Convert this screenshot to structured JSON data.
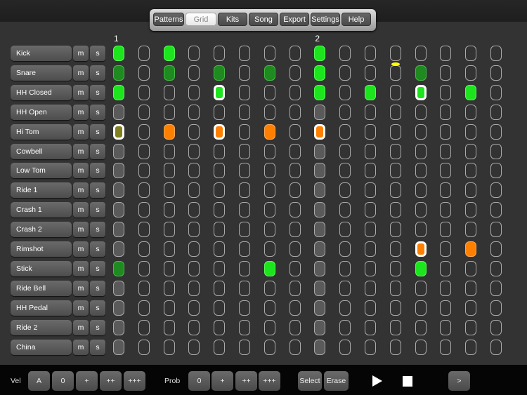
{
  "tabs": [
    {
      "label": "Patterns"
    },
    {
      "label": "Grid",
      "active": true
    },
    {
      "label": "Kits"
    },
    {
      "label": "Song"
    },
    {
      "label": "Export"
    },
    {
      "label": "Settings"
    },
    {
      "label": "Help"
    }
  ],
  "bar_markers": [
    "1",
    "2"
  ],
  "mute_label": "m",
  "solo_label": "s",
  "playhead_step": 11,
  "colors": {
    "bright_green": "#1de51d",
    "dark_green": "#1f8a1f",
    "orange": "#ff8000",
    "olive": "#808020",
    "playhead": "#ffff00"
  },
  "cell_legend": {
    ".": "off",
    "G": "on-high",
    "g": "on-low",
    "O": "on-orange",
    "y": "on-olive",
    "*": "selected"
  },
  "tracks": [
    {
      "name": "Kick",
      "steps": [
        "G",
        ".",
        "G",
        ".",
        ".",
        ".",
        ".",
        ".",
        "G",
        ".",
        ".",
        ".",
        ".",
        ".",
        ".",
        "."
      ]
    },
    {
      "name": "Snare",
      "steps": [
        "g",
        ".",
        "g",
        ".",
        "g",
        ".",
        "g",
        ".",
        "G",
        ".",
        ".",
        ".",
        "g",
        ".",
        ".",
        "."
      ]
    },
    {
      "name": "HH Closed",
      "steps": [
        "G",
        ".",
        ".",
        ".",
        "G*",
        ".",
        ".",
        ".",
        "G",
        ".",
        "G",
        ".",
        "G*",
        ".",
        "G",
        "."
      ]
    },
    {
      "name": "HH Open",
      "steps": [
        ".",
        ".",
        ".",
        ".",
        ".",
        ".",
        ".",
        ".",
        ".",
        ".",
        ".",
        ".",
        ".",
        ".",
        ".",
        "."
      ]
    },
    {
      "name": "Hi Tom",
      "steps": [
        "y*",
        ".",
        "O",
        ".",
        "O*",
        ".",
        "O",
        ".",
        "O*",
        ".",
        ".",
        ".",
        ".",
        ".",
        ".",
        "."
      ]
    },
    {
      "name": "Cowbell",
      "steps": [
        ".",
        ".",
        ".",
        ".",
        ".",
        ".",
        ".",
        ".",
        ".",
        ".",
        ".",
        ".",
        ".",
        ".",
        ".",
        "."
      ]
    },
    {
      "name": "Low Tom",
      "steps": [
        ".",
        ".",
        ".",
        ".",
        ".",
        ".",
        ".",
        ".",
        ".",
        ".",
        ".",
        ".",
        ".",
        ".",
        ".",
        "."
      ]
    },
    {
      "name": "Ride 1",
      "steps": [
        ".",
        ".",
        ".",
        ".",
        ".",
        ".",
        ".",
        ".",
        ".",
        ".",
        ".",
        ".",
        ".",
        ".",
        ".",
        "."
      ]
    },
    {
      "name": "Crash 1",
      "steps": [
        ".",
        ".",
        ".",
        ".",
        ".",
        ".",
        ".",
        ".",
        ".",
        ".",
        ".",
        ".",
        ".",
        ".",
        ".",
        "."
      ]
    },
    {
      "name": "Crash 2",
      "steps": [
        ".",
        ".",
        ".",
        ".",
        ".",
        ".",
        ".",
        ".",
        ".",
        ".",
        ".",
        ".",
        ".",
        ".",
        ".",
        "."
      ]
    },
    {
      "name": "Rimshot",
      "steps": [
        ".",
        ".",
        ".",
        ".",
        ".",
        ".",
        ".",
        ".",
        ".",
        ".",
        ".",
        ".",
        "O*",
        ".",
        "O",
        "."
      ]
    },
    {
      "name": "Stick",
      "steps": [
        "g",
        ".",
        ".",
        ".",
        ".",
        ".",
        "G",
        ".",
        ".",
        ".",
        ".",
        ".",
        "G",
        ".",
        ".",
        "."
      ]
    },
    {
      "name": "Ride Bell",
      "steps": [
        ".",
        ".",
        ".",
        ".",
        ".",
        ".",
        ".",
        ".",
        ".",
        ".",
        ".",
        ".",
        ".",
        ".",
        ".",
        "."
      ]
    },
    {
      "name": "HH Pedal",
      "steps": [
        ".",
        ".",
        ".",
        ".",
        ".",
        ".",
        ".",
        ".",
        ".",
        ".",
        ".",
        ".",
        ".",
        ".",
        ".",
        "."
      ]
    },
    {
      "name": "Ride 2",
      "steps": [
        ".",
        ".",
        ".",
        ".",
        ".",
        ".",
        ".",
        ".",
        ".",
        ".",
        ".",
        ".",
        ".",
        ".",
        ".",
        "."
      ]
    },
    {
      "name": "China",
      "steps": [
        ".",
        ".",
        ".",
        ".",
        ".",
        ".",
        ".",
        ".",
        ".",
        ".",
        ".",
        ".",
        ".",
        ".",
        ".",
        "."
      ]
    }
  ],
  "bottom": {
    "vel_label": "Vel",
    "vel_buttons": [
      "A",
      "0",
      "+",
      "++",
      "+++"
    ],
    "prob_label": "Prob",
    "prob_buttons": [
      "0",
      "+",
      "++",
      "+++"
    ],
    "select_label": "Select",
    "erase_label": "Erase",
    "next_label": ">"
  }
}
